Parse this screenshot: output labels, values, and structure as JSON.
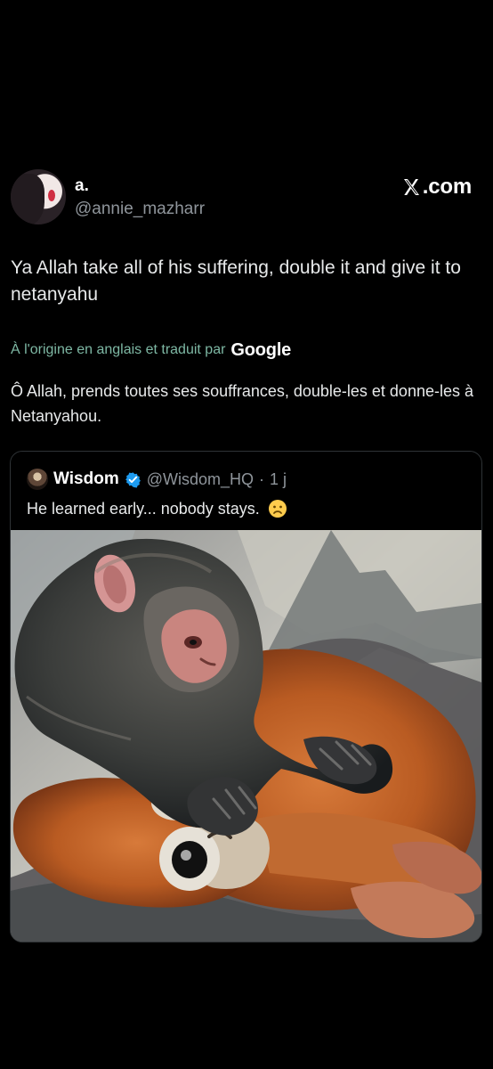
{
  "post": {
    "author": {
      "name": "a.",
      "handle": "@annie_mazharr",
      "avatar_icon": "profile-avatar"
    },
    "brand": {
      "label": ".com",
      "icon": "x-logo-icon"
    },
    "text": "Ya Allah take all of his suffering, double it and give it to netanyahu",
    "translation": {
      "label": "À l'origine en anglais et traduit par",
      "provider": "Google",
      "text": "Ô Allah, prends toutes ses souffrances, double-les et donne-les à Netanyahou."
    },
    "quote": {
      "author": {
        "name": "Wisdom",
        "handle": "@Wisdom_HQ",
        "separator": "·",
        "time": "1 j",
        "avatar_icon": "quote-avatar",
        "verified_icon": "verified-badge-icon"
      },
      "text": "He learned early... nobody stays.",
      "emoji_icon": "sad-face-icon",
      "image_icon": "monkey-with-plush-orangutan-image"
    }
  },
  "colors": {
    "background": "#000000",
    "primary_text": "#e7e9ea",
    "secondary_text": "#8f959b",
    "translation_text": "#7eb8a4",
    "card_border": "#2f3336",
    "verified_blue": "#1d9bf0"
  }
}
